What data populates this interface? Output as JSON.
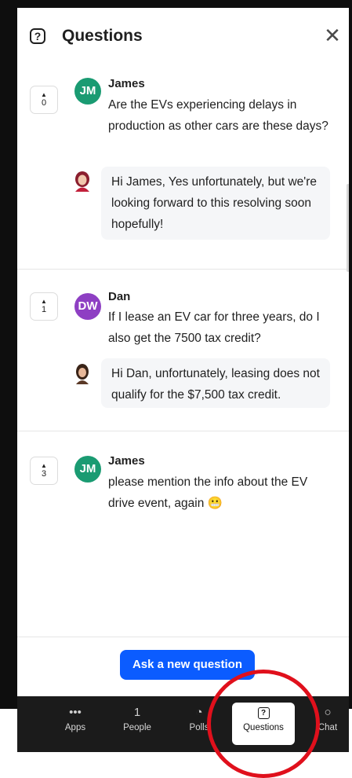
{
  "header": {
    "icon": "question-icon",
    "title": "Questions",
    "close_icon": "close-icon"
  },
  "questions": [
    {
      "votes": "0",
      "avatar": {
        "initials": "JM",
        "color": "#1a9b72"
      },
      "name": "James",
      "text": "Are the EVs experiencing delays in production as other cars are these days?",
      "reply": "Hi James, Yes unfortunately, but we're looking forward to this resolving soon hopefully!"
    },
    {
      "votes": "1",
      "avatar": {
        "initials": "DW",
        "color": "#8e3fc3"
      },
      "name": "Dan",
      "text": "If I lease an EV car for three years, do I also get the 7500 tax credit?",
      "reply": "Hi Dan, unfortunately, leasing does not qualify for the $7,500 tax credit."
    },
    {
      "votes": "3",
      "avatar": {
        "initials": "JM",
        "color": "#1a9b72"
      },
      "name": "James",
      "text": "please mention the info about the EV drive event, again",
      "emoji": "😬"
    }
  ],
  "footer": {
    "ask_label": "Ask a new question",
    "accent": "#0b5cff"
  },
  "toolbar": {
    "items": [
      {
        "label": "Apps",
        "icon": "•••"
      },
      {
        "label": "People",
        "icon": "1"
      },
      {
        "label": "Polls",
        "icon": "◔"
      },
      {
        "label": "Questions",
        "icon": "?"
      },
      {
        "label": "Chat",
        "icon": "○"
      }
    ]
  },
  "annotation_color": "#e0101c"
}
